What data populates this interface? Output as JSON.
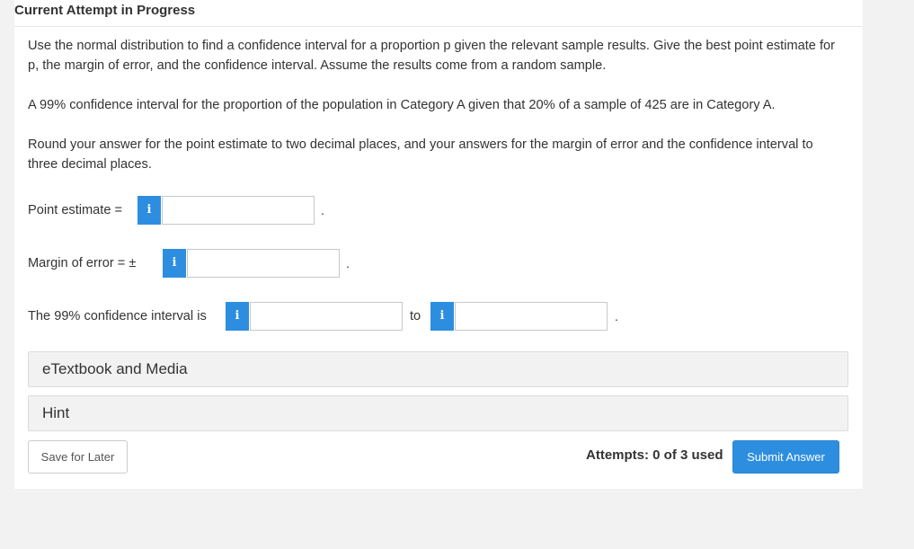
{
  "header": {
    "title": "Current Attempt in Progress"
  },
  "question": {
    "intro": "Use the normal distribution to find a confidence interval for a proportion p given the relevant sample results. Give the best point estimate for p, the margin of error, and the confidence interval. Assume the results come from a random sample.",
    "problem": "A 99% confidence interval for the proportion of the population in Category A given that 20% of a sample of 425 are in Category A.",
    "rounding": "Round your answer for the point estimate to two decimal places, and your answers for the margin of error and the confidence interval to three decimal places."
  },
  "fields": {
    "point_estimate_label": "Point estimate =",
    "margin_label": "Margin of error = ±",
    "interval_label": "The 99% confidence interval is",
    "to_label": "to",
    "info_icon": "i",
    "period": ".",
    "point_estimate_value": "",
    "margin_value": "",
    "interval_low_value": "",
    "interval_high_value": ""
  },
  "panels": {
    "etextbook": "eTextbook and Media",
    "hint": "Hint"
  },
  "footer": {
    "save_label": "Save for Later",
    "attempts": "Attempts: 0 of 3 used",
    "submit_label": "Submit Answer"
  },
  "colors": {
    "accent": "#2d8ee0",
    "page_bg": "#f2f2f2",
    "card_bg": "#ffffff"
  }
}
